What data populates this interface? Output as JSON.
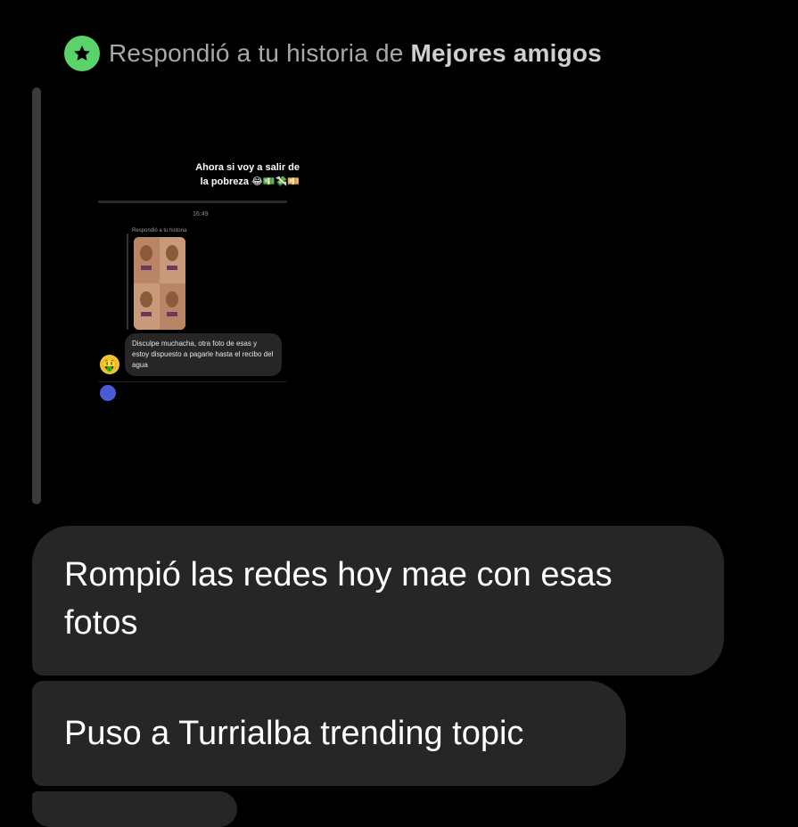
{
  "header": {
    "prefix": "Respondió a tu historia de",
    "audience": "Mejores amigos",
    "badge_color": "#5ad36a",
    "badge_icon": "star-icon"
  },
  "story": {
    "caption_line1": "Ahora si voy a salir de",
    "caption_line2": "la pobreza 😂💵💸💴",
    "inner_time": "16:49",
    "inner_reply_label": "Respondió a tu historia",
    "inner_message": "Disculpe muchacha, otra foto de esas y estoy dispuesto a pagarle hasta el recibo del agua",
    "inner_emoji": "🤑"
  },
  "messages": [
    {
      "text": "Rompió las redes hoy mae con esas fotos"
    },
    {
      "text": "Puso a Turrialba trending topic"
    }
  ],
  "colors": {
    "background": "#000000",
    "bubble": "#262626",
    "accent_green": "#5ad36a"
  }
}
